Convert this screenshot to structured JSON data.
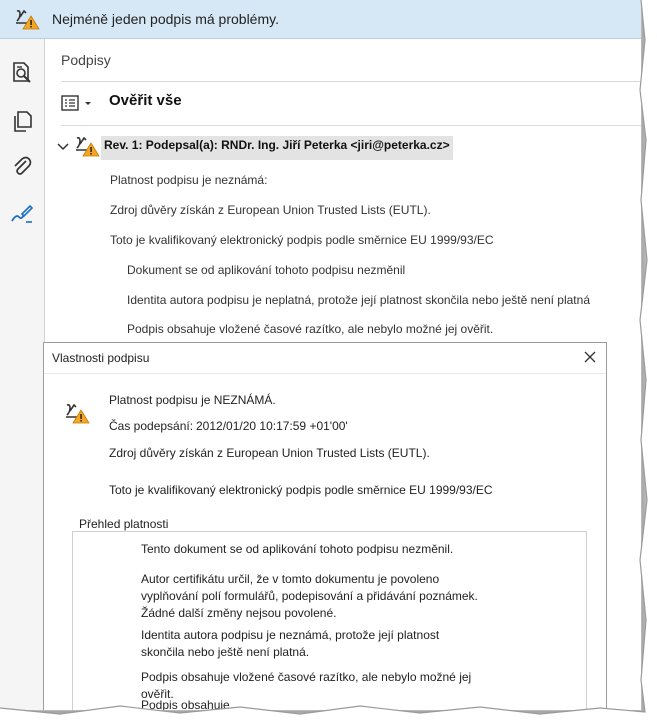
{
  "notification": {
    "text": "Nejméně jeden podpis má problémy."
  },
  "left_toolbar": {
    "icons": [
      "page-search-icon",
      "pages-icon",
      "attachment-icon",
      "signature-pen-icon"
    ]
  },
  "signature_panel": {
    "title": "Podpisy",
    "verify_all": "Ověřit vše",
    "revision_label": "Rev. 1: Podepsal(a): RNDr. Ing. Jiří Peterka <jiri@peterka.cz>",
    "details": [
      "Platnost podpisu je neznámá:",
      "Zdroj důvěry získán z European Union Trusted Lists (EUTL).",
      "Toto je kvalifikovaný elektronický podpis podle směrnice EU 1999/93/EC"
    ],
    "subdetails": [
      "Dokument se od aplikování tohoto podpisu nezměnil",
      "Identita autora podpisu je neplatná, protože její platnost skončila nebo ještě není platná",
      "Podpis obsahuje vložené časové razítko, ale nebylo možné jej ověřit."
    ]
  },
  "dialog": {
    "title": "Vlastnosti podpisu",
    "status": "Platnost podpisu je NEZNÁMÁ.",
    "sign_time_label": "Čas podepsání:",
    "sign_time_value": "2012/01/20 10:17:59 +01'00'",
    "trust_source": "Zdroj důvěry získán z European Union Trusted Lists (EUTL).",
    "qualified": "Toto je kvalifikovaný elektronický podpis podle směrnice EU 1999/93/EC",
    "summary_title": "Přehled platnosti",
    "summary": [
      "Tento dokument se od aplikování tohoto podpisu nezměnil.",
      "Autor certifikátu určil, že v tomto dokumentu je povoleno vyplňování polí formulářů, podepisování a přidávání poznámek. Žádné další změny nejsou povolené.",
      "Identita autora podpisu je neznámá, protože její platnost skončila nebo ještě není platná.",
      "Podpis obsahuje vložené časové razítko, ale nebylo možné jej ověřit.",
      "Podpis obsahuje..."
    ]
  },
  "colors": {
    "notification_bg": "#d6e8f6",
    "warning": "#f5a623",
    "accent_icon": "#1a6fc7"
  }
}
